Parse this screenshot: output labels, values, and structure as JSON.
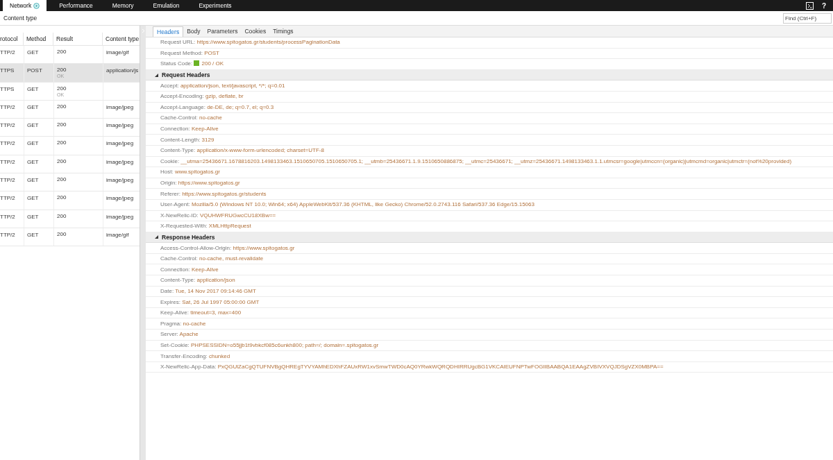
{
  "tabs": [
    {
      "label": "Network",
      "selected": true,
      "recording": true
    },
    {
      "label": "Performance",
      "selected": false,
      "recording": false
    },
    {
      "label": "Memory",
      "selected": false,
      "recording": false
    },
    {
      "label": "Emulation",
      "selected": false,
      "recording": false
    },
    {
      "label": "Experiments",
      "selected": false,
      "recording": false
    }
  ],
  "help_label": "?",
  "filter_label": "Content type",
  "find": {
    "placeholder": "Find (Ctrl+F)"
  },
  "requests": {
    "columns": [
      "rotocol",
      "Method",
      "Result",
      "Content type"
    ],
    "rows": [
      {
        "protocol": "TTP/2",
        "method": "GET",
        "result": "200",
        "content_type": "image/gif",
        "selected": false
      },
      {
        "protocol": "TTPS",
        "method": "POST",
        "result": "200",
        "result_note": "OK",
        "content_type": "application/js",
        "selected": true
      },
      {
        "protocol": "TTPS",
        "method": "GET",
        "result": "200",
        "result_note": "OK",
        "selected": false
      },
      {
        "protocol": "TTP/2",
        "method": "GET",
        "result": "200",
        "content_type": "image/jpeg",
        "selected": false
      },
      {
        "protocol": "TTP/2",
        "method": "GET",
        "result": "200",
        "content_type": "image/jpeg",
        "selected": false
      },
      {
        "protocol": "TTP/2",
        "method": "GET",
        "result": "200",
        "content_type": "image/jpeg",
        "selected": false
      },
      {
        "protocol": "TTP/2",
        "method": "GET",
        "result": "200",
        "content_type": "image/jpeg",
        "selected": false
      },
      {
        "protocol": "TTP/2",
        "method": "GET",
        "result": "200",
        "content_type": "image/jpeg",
        "selected": false
      },
      {
        "protocol": "TTP/2",
        "method": "GET",
        "result": "200",
        "content_type": "image/jpeg",
        "selected": false
      },
      {
        "protocol": "TTP/2",
        "method": "GET",
        "result": "200",
        "content_type": "image/jpeg",
        "selected": false
      },
      {
        "protocol": "TTP/2",
        "method": "GET",
        "result": "200",
        "content_type": "image/gif",
        "selected": false
      }
    ]
  },
  "detail_tabs": [
    {
      "label": "Headers",
      "selected": true
    },
    {
      "label": "Body",
      "selected": false
    },
    {
      "label": "Parameters",
      "selected": false
    },
    {
      "label": "Cookies",
      "selected": false
    },
    {
      "label": "Timings",
      "selected": false
    }
  ],
  "general": [
    {
      "kind": "plain",
      "name": "Request URL:",
      "value": "https://www.spitogatos.gr/students/processPaginationData"
    },
    {
      "kind": "plain",
      "name": "Request Method:",
      "value": "POST"
    },
    {
      "kind": "status",
      "name": "Status Code:",
      "value": "200 / OK",
      "color": "#6bb324"
    }
  ],
  "sections": [
    {
      "title": "Request Headers",
      "expanded": true,
      "headers": [
        {
          "name": "Accept:",
          "value": "application/json, text/javascript, */*; q=0.01"
        },
        {
          "name": "Accept-Encoding:",
          "value": "gzip, deflate, br"
        },
        {
          "name": "Accept-Language:",
          "value": "de-DE, de; q=0.7, el; q=0.3"
        },
        {
          "name": "Cache-Control:",
          "value": "no-cache"
        },
        {
          "name": "Connection:",
          "value": "Keep-Alive"
        },
        {
          "name": "Content-Length:",
          "value": "3129"
        },
        {
          "name": "Content-Type:",
          "value": "application/x-www-form-urlencoded; charset=UTF-8"
        },
        {
          "name": "Cookie:",
          "value": "__utma=25436671.1678816203.1498133463.1510650705.1510650705.1; __utmb=25436671.1.9.1510650886875; __utmc=25436671; __utmz=25436671.1498133463.1.1.utmcsr=google|utmccn=(organic)|utmcmd=organic|utmctr=(not%20provided)"
        },
        {
          "name": "Host:",
          "value": "www.spitogatos.gr"
        },
        {
          "name": "Origin:",
          "value": "https://www.spitogatos.gr"
        },
        {
          "name": "Referer:",
          "value": "https://www.spitogatos.gr/students"
        },
        {
          "name": "User-Agent:",
          "value": "Mozilla/5.0 (Windows NT 10.0; Win64; x64) AppleWebKit/537.36 (KHTML, like Gecko) Chrome/52.0.2743.116 Safari/537.36 Edge/15.15063"
        },
        {
          "name": "X-NewRelic-ID:",
          "value": "VQUHWFRUGwcCU18XBw=="
        },
        {
          "name": "X-Requested-With:",
          "value": "XMLHttpRequest"
        }
      ]
    },
    {
      "title": "Response Headers",
      "expanded": true,
      "headers": [
        {
          "name": "Access-Control-Allow-Origin:",
          "value": "https://www.spitogatos.gr"
        },
        {
          "name": "Cache-Control:",
          "value": "no-cache, must-revalidate"
        },
        {
          "name": "Connection:",
          "value": "Keep-Alive"
        },
        {
          "name": "Content-Type:",
          "value": "application/json"
        },
        {
          "name": "Date:",
          "value": "Tue, 14 Nov 2017 09:14:46 GMT"
        },
        {
          "name": "Expires:",
          "value": "Sat, 26 Jul 1997 05:00:00 GMT"
        },
        {
          "name": "Keep-Alive:",
          "value": "timeout=3, max=400"
        },
        {
          "name": "Pragma:",
          "value": "no-cache"
        },
        {
          "name": "Server:",
          "value": "Apache"
        },
        {
          "name": "Set-Cookie:",
          "value": "PHPSESSIDN=o55jjb1t9vbkcf085c6unkh800; path=/; domain=.spitogatos.gr"
        },
        {
          "name": "Transfer-Encoding:",
          "value": "chunked"
        },
        {
          "name": "X-NewRelic-App-Data:",
          "value": "PxQGUlZaCgQTUFNVBgQHREgTYVYAMhEDXhFZAUxRW1xvSmwTWD0cAQ0YRwkWQRQDHIRRUgcBG1VKCAIEUFNPTwFOGIIBAABQA1EAAgZVBIVXVQJDSgVZX0MBPA=="
        }
      ]
    }
  ]
}
